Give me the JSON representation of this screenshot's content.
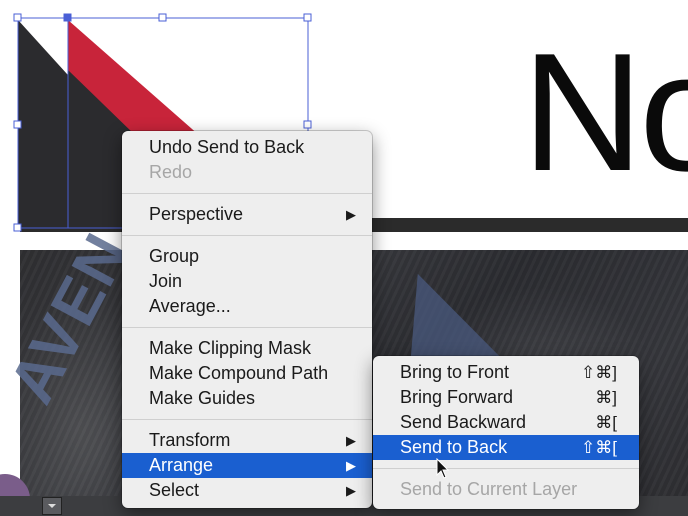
{
  "canvas": {
    "headline_fragment": "No",
    "photo_text": "AVEN"
  },
  "context_menu": {
    "groups": [
      [
        {
          "label": "Undo Send to Back",
          "enabled": true
        },
        {
          "label": "Redo",
          "enabled": false
        }
      ],
      [
        {
          "label": "Perspective",
          "submenu": true
        }
      ],
      [
        {
          "label": "Group"
        },
        {
          "label": "Join"
        },
        {
          "label": "Average..."
        }
      ],
      [
        {
          "label": "Make Clipping Mask"
        },
        {
          "label": "Make Compound Path"
        },
        {
          "label": "Make Guides"
        }
      ],
      [
        {
          "label": "Transform",
          "submenu": true
        },
        {
          "label": "Arrange",
          "submenu": true,
          "highlighted": true
        },
        {
          "label": "Select",
          "submenu": true
        }
      ]
    ],
    "submenu_arrow": "▶"
  },
  "arrange_submenu": {
    "items": [
      {
        "label": "Bring to Front",
        "shortcut": "⇧⌘]"
      },
      {
        "label": "Bring Forward",
        "shortcut": "⌘]"
      },
      {
        "label": "Send Backward",
        "shortcut": "⌘["
      },
      {
        "label": "Send to Back",
        "shortcut": "⇧⌘[",
        "highlighted": true
      }
    ],
    "disabled_item": {
      "label": "Send to Current Layer",
      "enabled": false
    }
  },
  "colors": {
    "menu_bg": "#eeeeee",
    "highlight": "#1a5fd0",
    "selection": "#4a5fd6",
    "triangle_dark": "#2b2b2e",
    "triangle_red": "#c8243a"
  }
}
